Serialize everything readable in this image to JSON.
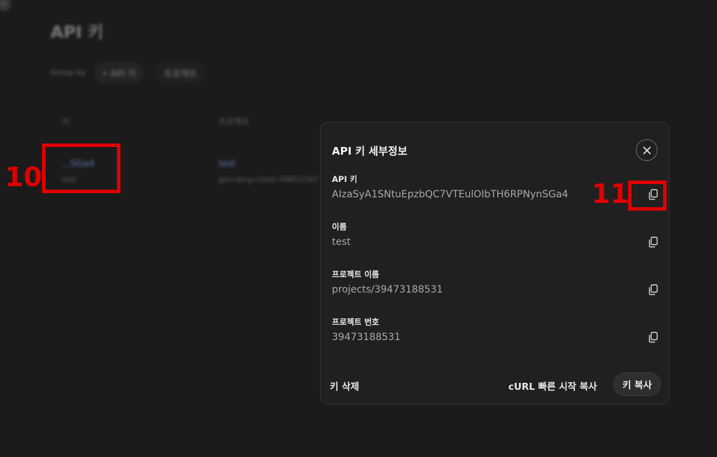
{
  "background": {
    "corner_badge": "ID",
    "page_title": "API 키",
    "group_by_label": "Group by",
    "chips": [
      "• API 키",
      "프로젝트"
    ],
    "columns": [
      "키",
      "프로젝트"
    ],
    "row": {
      "key_link": "...SGa4",
      "key_sub": "test",
      "project_link": "test",
      "project_sub": "gen-lang-client-00652347"
    }
  },
  "dialog": {
    "title": "API 키 세부정보",
    "fields": [
      {
        "label": "API 키",
        "value": "AIzaSyA1SNtuEpzbQC7VTEulOIbTH6RPNynSGa4"
      },
      {
        "label": "이름",
        "value": "test"
      },
      {
        "label": "프로젝트 이름",
        "value": "projects/39473188531"
      },
      {
        "label": "프로젝트 번호",
        "value": "39473188531"
      }
    ],
    "footer": {
      "delete_label": "키 삭제",
      "curl_label": "cURL 빠른 시작 복사",
      "copy_key_label": "키 복사"
    }
  },
  "annotations": {
    "label_10": "10",
    "label_11": "11",
    "color": "#e00000"
  }
}
